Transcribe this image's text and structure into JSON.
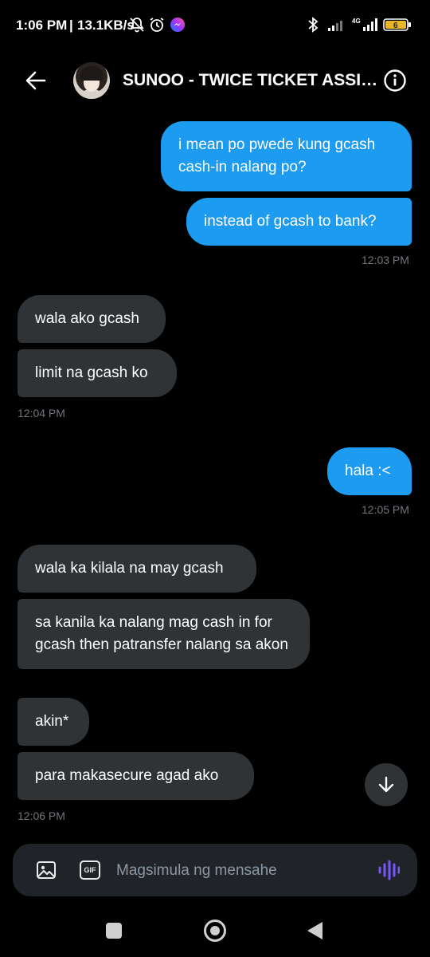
{
  "status_bar": {
    "time": "1:06 PM",
    "separator": "|",
    "net_speed": "13.1KB/s",
    "icons": [
      "mute-bell-icon",
      "alarm-icon",
      "messenger-icon",
      "bluetooth-icon",
      "signal-icon",
      "signal-4g-icon",
      "battery-icon"
    ],
    "battery_level": "6"
  },
  "header": {
    "title": "SUNOO - TWICE TICKET ASSISTANCE",
    "back_icon": "arrow-left-icon",
    "info_icon": "info-icon"
  },
  "messages": [
    {
      "id": "m1",
      "side": "sent",
      "text": "i mean po pwede kung gcash cash-in nalang po?"
    },
    {
      "id": "m2",
      "side": "sent",
      "text": "instead of gcash to bank?"
    },
    {
      "id": "t1",
      "type": "timestamp",
      "text": "12:03 PM"
    },
    {
      "id": "m3",
      "side": "received",
      "text": "wala ako gcash"
    },
    {
      "id": "m4",
      "side": "received",
      "text": "limit na gcash ko"
    },
    {
      "id": "t2",
      "type": "timestamp",
      "text": "12:04 PM"
    },
    {
      "id": "m5",
      "side": "sent",
      "text": "hala :<"
    },
    {
      "id": "t3",
      "type": "timestamp",
      "text": "12:05 PM"
    },
    {
      "id": "m6",
      "side": "received",
      "text": "wala ka kilala na may gcash"
    },
    {
      "id": "m7",
      "side": "received",
      "text": "sa kanila ka nalang mag cash in for gcash then patransfer nalang sa akon"
    },
    {
      "id": "m8",
      "side": "received",
      "text": "akin*"
    },
    {
      "id": "m9",
      "side": "received",
      "text": "para makasecure agad ako"
    },
    {
      "id": "t4",
      "type": "timestamp",
      "text": "12:06 PM"
    }
  ],
  "composer": {
    "placeholder": "Magsimula ng mensahe",
    "value": "",
    "gif_label": "GIF",
    "image_icon": "image-icon",
    "voice_icon": "voice-waveform-icon"
  },
  "colors": {
    "sent_bubble": "#1d9bf0",
    "received_bubble": "#2f3336",
    "background": "#000000",
    "voice_accent": "#7856ff"
  }
}
